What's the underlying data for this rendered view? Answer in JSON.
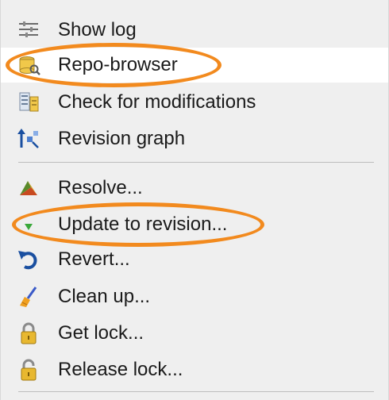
{
  "menu": {
    "items": [
      {
        "label": "Show log",
        "icon": "show-log-icon"
      },
      {
        "label": "Repo-browser",
        "icon": "repo-browser-icon"
      },
      {
        "label": "Check for modifications",
        "icon": "check-modifications-icon"
      },
      {
        "label": "Revision graph",
        "icon": "revision-graph-icon"
      },
      {
        "label": "Resolve...",
        "icon": "resolve-icon"
      },
      {
        "label": "Update to revision...",
        "icon": "update-icon"
      },
      {
        "label": "Revert...",
        "icon": "revert-icon"
      },
      {
        "label": "Clean up...",
        "icon": "cleanup-icon"
      },
      {
        "label": "Get lock...",
        "icon": "lock-icon"
      },
      {
        "label": "Release lock...",
        "icon": "unlock-icon"
      }
    ]
  },
  "colors": {
    "menu_background": "#efefef",
    "highlight_background": "#ffffff",
    "annotation_ring": "#f28a1e",
    "separator": "#bdbdbd"
  }
}
